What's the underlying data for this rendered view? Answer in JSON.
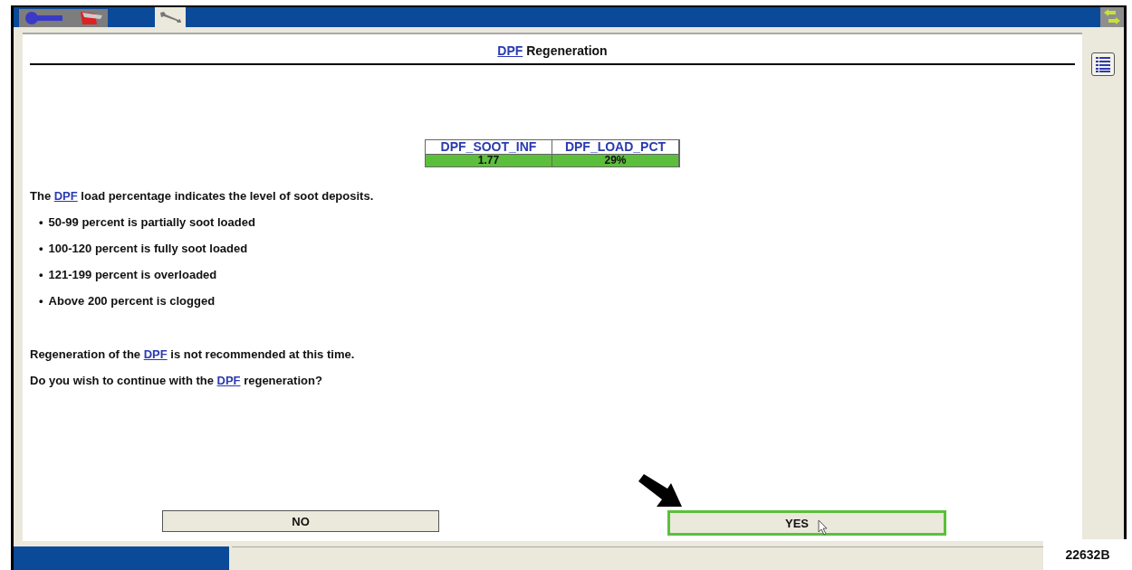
{
  "tabs": [
    {
      "kind": "tools",
      "selected": false
    },
    {
      "kind": "wrench",
      "selected": true
    }
  ],
  "title": [
    {
      "text": "DPF",
      "link": true
    },
    {
      "text": " Regeneration",
      "link": false
    }
  ],
  "table": {
    "columns": [
      "DPF_SOOT_INF",
      "DPF_LOAD_PCT"
    ],
    "values": [
      "1.77",
      "29%"
    ],
    "color": "#5cbf3c"
  },
  "intro": [
    {
      "text": "The ",
      "link": false
    },
    {
      "text": "DPF",
      "link": true
    },
    {
      "text": " load percentage indicates the level of soot deposits.",
      "link": false
    }
  ],
  "bullets": [
    {
      "mark": "•",
      "text": "50-99 percent is partially soot loaded"
    },
    {
      "mark": "•",
      "text": "100-120 percent is fully soot loaded"
    },
    {
      "mark": "•",
      "text": "121-199 percent is overloaded"
    },
    {
      "mark": "•",
      "text": "Above 200 percent is clogged"
    }
  ],
  "notes": [
    [
      {
        "text": "Regeneration of the ",
        "link": false
      },
      {
        "text": "DPF",
        "link": true
      },
      {
        "text": " is not recommended at this time.",
        "link": false
      }
    ],
    [
      {
        "text": "Do you wish to continue with the ",
        "link": false
      },
      {
        "text": "DPF",
        "link": true
      },
      {
        "text": " regeneration?",
        "link": false
      }
    ]
  ],
  "buttons": [
    {
      "label": "NO",
      "selected": false
    },
    {
      "label": "YES",
      "selected": true
    }
  ],
  "figure_id": "22632B"
}
